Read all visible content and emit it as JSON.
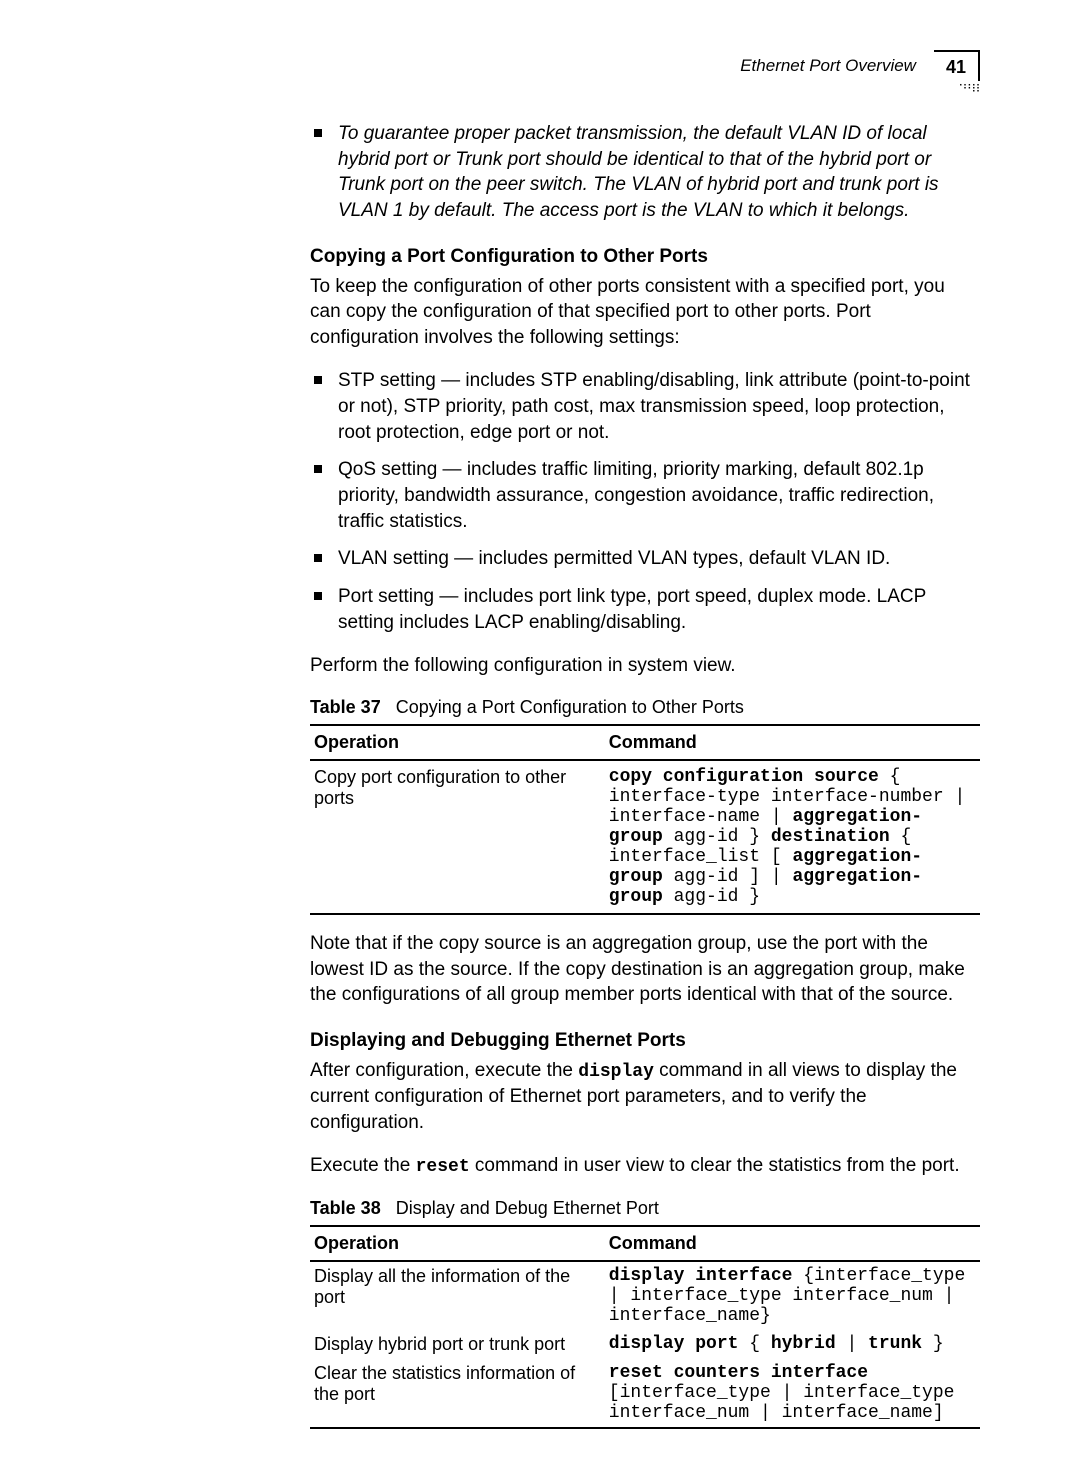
{
  "header": {
    "title": "Ethernet Port Overview",
    "page": "41"
  },
  "intro_bullet": "To guarantee proper packet transmission, the default VLAN ID of local hybrid port or Trunk port should be identical to that of the hybrid port or Trunk port on the peer switch. The VLAN of hybrid port and trunk port is VLAN 1 by default. The access port is the VLAN to which it belongs.",
  "copy": {
    "heading": "Copying a Port Configuration to Other Ports",
    "intro": "To keep the configuration of other ports consistent with a specified port, you can copy the configuration of that specified port to other ports. Port configuration involves the following settings:",
    "bullets": [
      "STP setting — includes STP enabling/disabling, link attribute (point-to-point or not), STP priority, path cost, max transmission speed, loop protection, root protection, edge port or not.",
      "QoS setting — includes traffic limiting, priority marking, default 802.1p priority, bandwidth assurance, congestion avoidance, traffic redirection, traffic statistics.",
      "VLAN setting — includes permitted VLAN types, default VLAN ID.",
      "Port setting — includes port link type, port speed, duplex mode. LACP setting includes LACP enabling/disabling."
    ],
    "perform": "Perform the following configuration in system view.",
    "table_caption_label": "Table 37",
    "table_caption_text": "Copying a Port Configuration to Other Ports",
    "table_headers": {
      "op": "Operation",
      "cmd": "Command"
    },
    "table_rows": [
      {
        "op": "Copy port configuration to other ports",
        "cmd_parts": {
          "p1b": "copy configuration source",
          "p1r": " { interface-type interface-number | interface-name | ",
          "p2b": "aggregation-group",
          "p2r": " agg-id } ",
          "p3b": "destination",
          "p3r": " { interface_list [ ",
          "p4b": "aggregation-group",
          "p4r": " agg-id ] | ",
          "p5b": "aggregation-group",
          "p5r": " agg-id }"
        }
      }
    ],
    "note": "Note that if the copy source is an aggregation group, use the port with the lowest ID as the source. If the copy destination is an aggregation group, make the configurations of all group member ports identical with that of the source."
  },
  "display": {
    "heading": "Displaying and Debugging Ethernet Ports",
    "intro_parts": {
      "a": "After configuration, execute the ",
      "code": "display",
      "b": " command in all views to display the current configuration of Ethernet port parameters, and to verify the configuration."
    },
    "reset_parts": {
      "a": "Execute the ",
      "code": "reset",
      "b": " command in user view to clear the statistics from the port."
    },
    "table_caption_label": "Table 38",
    "table_caption_text": "Display and Debug Ethernet Port",
    "table_headers": {
      "op": "Operation",
      "cmd": "Command"
    },
    "table_rows": [
      {
        "op": "Display all the information of the port",
        "cmd": {
          "b1": "display interface",
          "r1": " {interface_type | interface_type interface_num | interface_name}"
        }
      },
      {
        "op": "Display hybrid port or trunk port",
        "cmd": {
          "b1": "display port",
          "r1": " { ",
          "b2": "hybrid",
          "r2": " | ",
          "b3": "trunk",
          "r3": " }"
        }
      },
      {
        "op": "Clear the statistics information of the port",
        "cmd": {
          "b1": "reset counters interface",
          "r1": " [interface_type | interface_type interface_num | interface_name]"
        }
      }
    ]
  }
}
